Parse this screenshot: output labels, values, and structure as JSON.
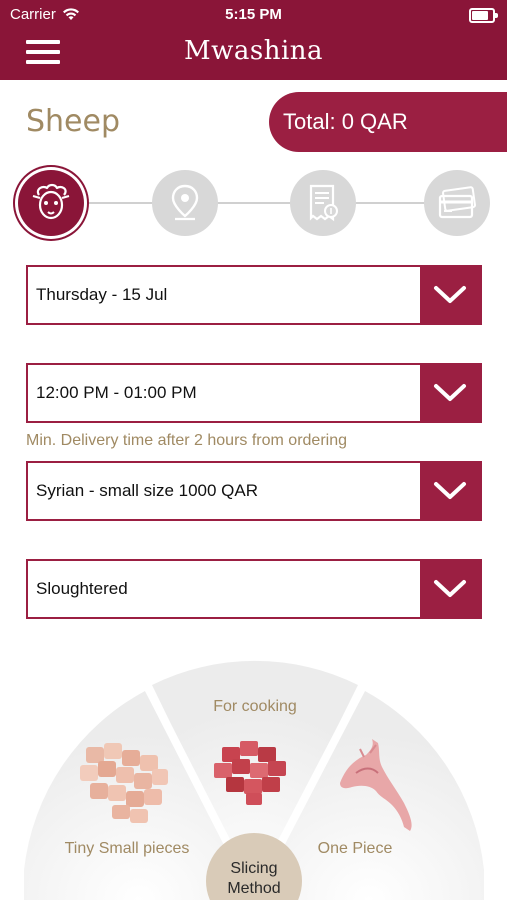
{
  "status_bar": {
    "carrier": "Carrier",
    "time": "5:15 PM"
  },
  "nav": {
    "title": "Mwashina"
  },
  "page": {
    "title": "Sheep",
    "total": "Total: 0 QAR"
  },
  "stepper": {
    "steps": [
      "sheep-icon",
      "location-pin-icon",
      "receipt-icon",
      "payment-card-icon"
    ],
    "active_index": 0
  },
  "dropdowns": {
    "date": "Thursday - 15 Jul",
    "time_slot": "12:00 PM - 01:00 PM",
    "sheep_type": "Syrian - small size 1000 QAR",
    "processing": "Sloughtered"
  },
  "delivery_note": "Min. Delivery time after 2 hours from ordering",
  "slicing": {
    "center_label_line1": "Slicing",
    "center_label_line2": "Method",
    "options": [
      "Tiny Small pieces",
      "For cooking",
      "One Piece"
    ]
  },
  "colors": {
    "brand": "#8a1538",
    "accent": "#9b1f42",
    "gold_text": "#a08a63",
    "inactive_step": "#d8d8d8"
  }
}
